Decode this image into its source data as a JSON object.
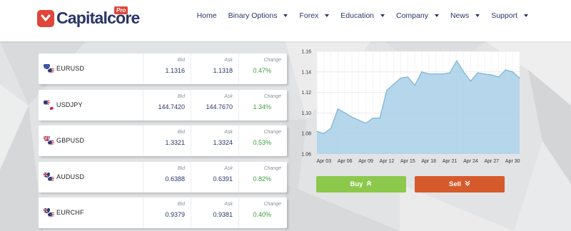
{
  "brand": {
    "name": "Capitalcore",
    "badge": "Pro",
    "accent": "#e0463a",
    "primary": "#2a3566"
  },
  "nav": [
    {
      "label": "Home",
      "dropdown": false
    },
    {
      "label": "Binary Options",
      "dropdown": true
    },
    {
      "label": "Forex",
      "dropdown": true
    },
    {
      "label": "Education",
      "dropdown": true
    },
    {
      "label": "Company",
      "dropdown": true
    },
    {
      "label": "News",
      "dropdown": true
    },
    {
      "label": "Support",
      "dropdown": true
    }
  ],
  "quote_headers": {
    "bid": "Bid",
    "ask": "Ask",
    "change": "Change"
  },
  "quotes": [
    {
      "symbol": "EURUSD",
      "bid": "1.1316",
      "ask": "1.1318",
      "change": "0.47%",
      "flags": [
        "eu-flag-icon",
        "us-flag-icon"
      ]
    },
    {
      "symbol": "USDJPY",
      "bid": "144.7420",
      "ask": "144.7670",
      "change": "1.34%",
      "flags": [
        "us-flag-icon",
        "jp-flag-icon"
      ]
    },
    {
      "symbol": "GBPUSD",
      "bid": "1.3321",
      "ask": "1.3324",
      "change": "0.53%",
      "flags": [
        "uk-flag-icon",
        "us-flag-icon"
      ]
    },
    {
      "symbol": "AUDUSD",
      "bid": "0.6388",
      "ask": "0.6391",
      "change": "0.82%",
      "flags": [
        "au-flag-icon",
        "us-flag-icon"
      ]
    },
    {
      "symbol": "EURCHF",
      "bid": "0.9379",
      "ask": "0.9381",
      "change": "0.40%",
      "flags": [
        "au-flag-icon",
        "us-flag-icon"
      ]
    }
  ],
  "chart_data": {
    "type": "area",
    "x": [
      "Apr 02",
      "Apr 03",
      "Apr 04",
      "Apr 05",
      "Apr 06",
      "Apr 07",
      "Apr 08",
      "Apr 09",
      "Apr 10",
      "Apr 11",
      "Apr 12",
      "Apr 13",
      "Apr 14",
      "Apr 15",
      "Apr 16",
      "Apr 17",
      "Apr 18",
      "Apr 19",
      "Apr 20",
      "Apr 21",
      "Apr 22",
      "Apr 23",
      "Apr 24",
      "Apr 25",
      "Apr 26",
      "Apr 27",
      "Apr 28",
      "Apr 29",
      "Apr 30",
      "May 01"
    ],
    "values": [
      1.082,
      1.08,
      1.085,
      1.104,
      1.1,
      1.096,
      1.093,
      1.09,
      1.095,
      1.095,
      1.122,
      1.128,
      1.134,
      1.135,
      1.127,
      1.14,
      1.138,
      1.138,
      1.138,
      1.139,
      1.151,
      1.14,
      1.131,
      1.139,
      1.138,
      1.137,
      1.135,
      1.142,
      1.14,
      1.134
    ],
    "x_tick_labels": [
      "Apr 03",
      "Apr 06",
      "Apr 09",
      "Apr 12",
      "Apr 15",
      "Apr 18",
      "Apr 21",
      "Apr 24",
      "Apr 27",
      "Apr 30"
    ],
    "y_ticks": [
      "1.06",
      "1.08",
      "1.10",
      "1.12",
      "1.14",
      "1.16"
    ],
    "ylim": [
      1.06,
      1.16
    ],
    "grid": true,
    "fill_color": "#a9cfe8",
    "line_color": "#7bb3d9"
  },
  "actions": {
    "buy_label": "Buy",
    "sell_label": "Sell",
    "buy_color": "#8cc84b",
    "sell_color": "#d65a2c"
  }
}
